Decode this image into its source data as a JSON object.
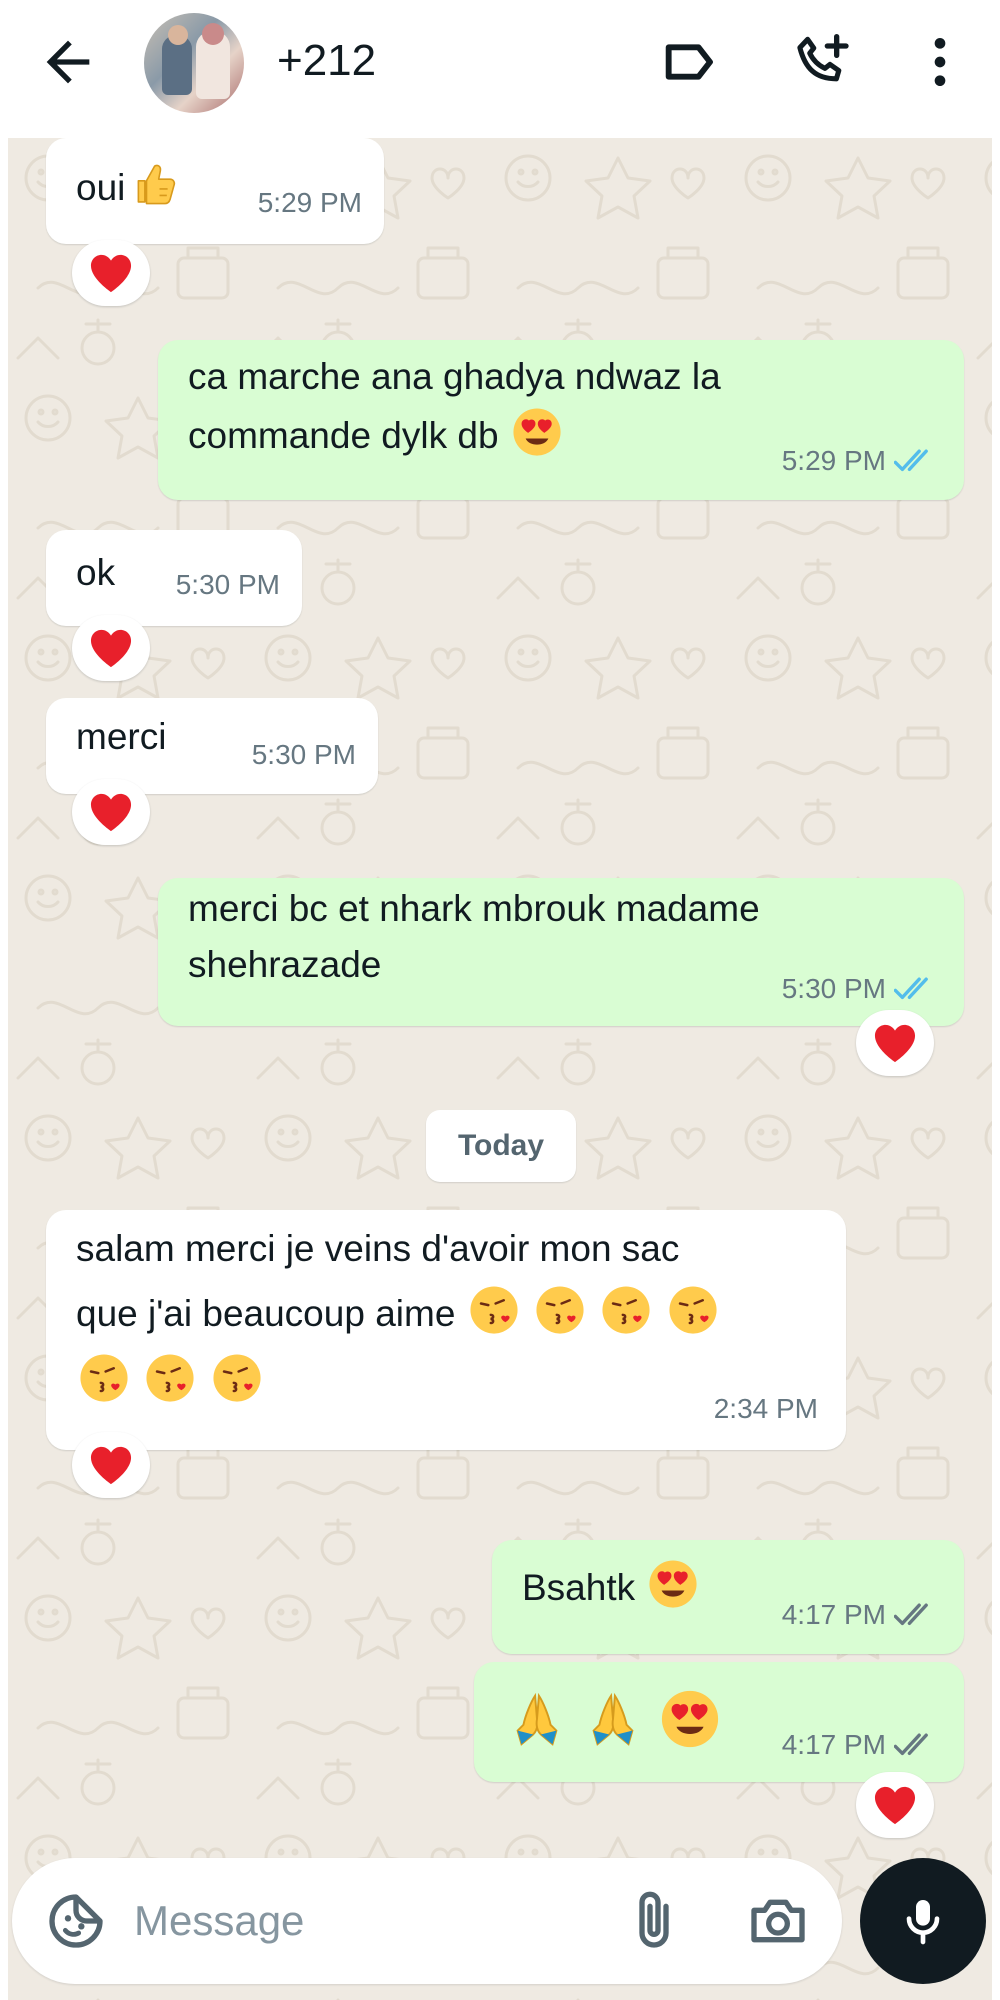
{
  "header": {
    "contact_name": "+212",
    "icons": [
      "back-arrow-icon",
      "label-icon",
      "add-call-icon",
      "more-vertical-icon"
    ]
  },
  "messages": [
    {
      "dir": "in",
      "text": "oui",
      "emoji": [
        "thumbs-up"
      ],
      "time": "5:29 PM",
      "reaction": "red-heart"
    },
    {
      "dir": "out",
      "line1": "ca marche ana ghadya ndwaz la",
      "line2": "commande dylk db",
      "emoji": [
        "heart-eyes"
      ],
      "time": "5:29 PM",
      "status": "read"
    },
    {
      "dir": "in",
      "text": "ok",
      "time": "5:30 PM",
      "reaction": "red-heart"
    },
    {
      "dir": "in",
      "text": "merci",
      "time": "5:30 PM",
      "reaction": "red-heart"
    },
    {
      "dir": "out",
      "line1": "merci bc et nhark mbrouk madame",
      "line2": "shehrazade",
      "time": "5:30 PM",
      "status": "read",
      "reaction": "red-heart"
    },
    {
      "dir": "in",
      "line1": "salam merci je veins d'avoir mon sac",
      "line2": "que j'ai beaucoup aime",
      "emoji": [
        "kiss",
        "kiss",
        "kiss",
        "kiss",
        "kiss",
        "kiss",
        "kiss"
      ],
      "time": "2:34 PM",
      "reaction": "red-heart"
    },
    {
      "dir": "out",
      "text": "Bsahtk",
      "emoji": [
        "heart-eyes"
      ],
      "time": "4:17 PM",
      "status": "delivered"
    },
    {
      "dir": "out",
      "emoji": [
        "folded-hands",
        "folded-hands",
        "heart-eyes"
      ],
      "time": "4:17 PM",
      "status": "delivered",
      "reaction": "red-heart"
    }
  ],
  "date_divider": "Today",
  "composer": {
    "placeholder": "Message",
    "icons": [
      "sticker-icon",
      "attach-icon",
      "camera-icon",
      "mic-icon"
    ]
  },
  "colors": {
    "incoming_bubble": "#ffffff",
    "outgoing_bubble": "#d9fdd3",
    "chat_background": "#efeae2",
    "read_ticks": "#53bdeb",
    "delivered_ticks": "#667781",
    "reaction_heart": "#e8202b"
  }
}
